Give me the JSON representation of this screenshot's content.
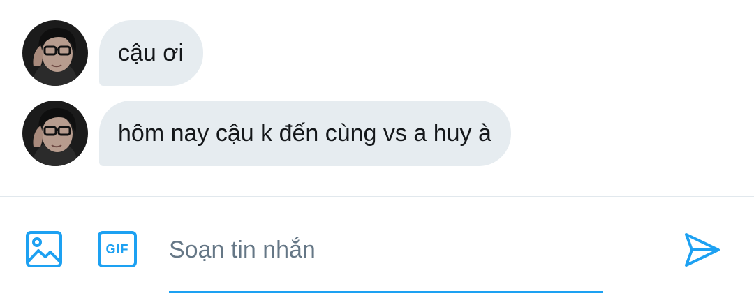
{
  "messages": [
    {
      "text": "cậu ơi"
    },
    {
      "text": "hôm nay cậu k đến cùng vs a huy à"
    }
  ],
  "composer": {
    "placeholder": "Soạn tin nhắn",
    "gif_label": "GIF"
  },
  "icons": {
    "image": "image-icon",
    "gif": "gif-icon",
    "send": "send-icon",
    "avatar": "avatar"
  },
  "colors": {
    "accent": "#1da1f2",
    "bubble_bg": "#e6ecf0",
    "text": "#14171a",
    "placeholder": "#657786",
    "divider": "#e1e8ed"
  }
}
